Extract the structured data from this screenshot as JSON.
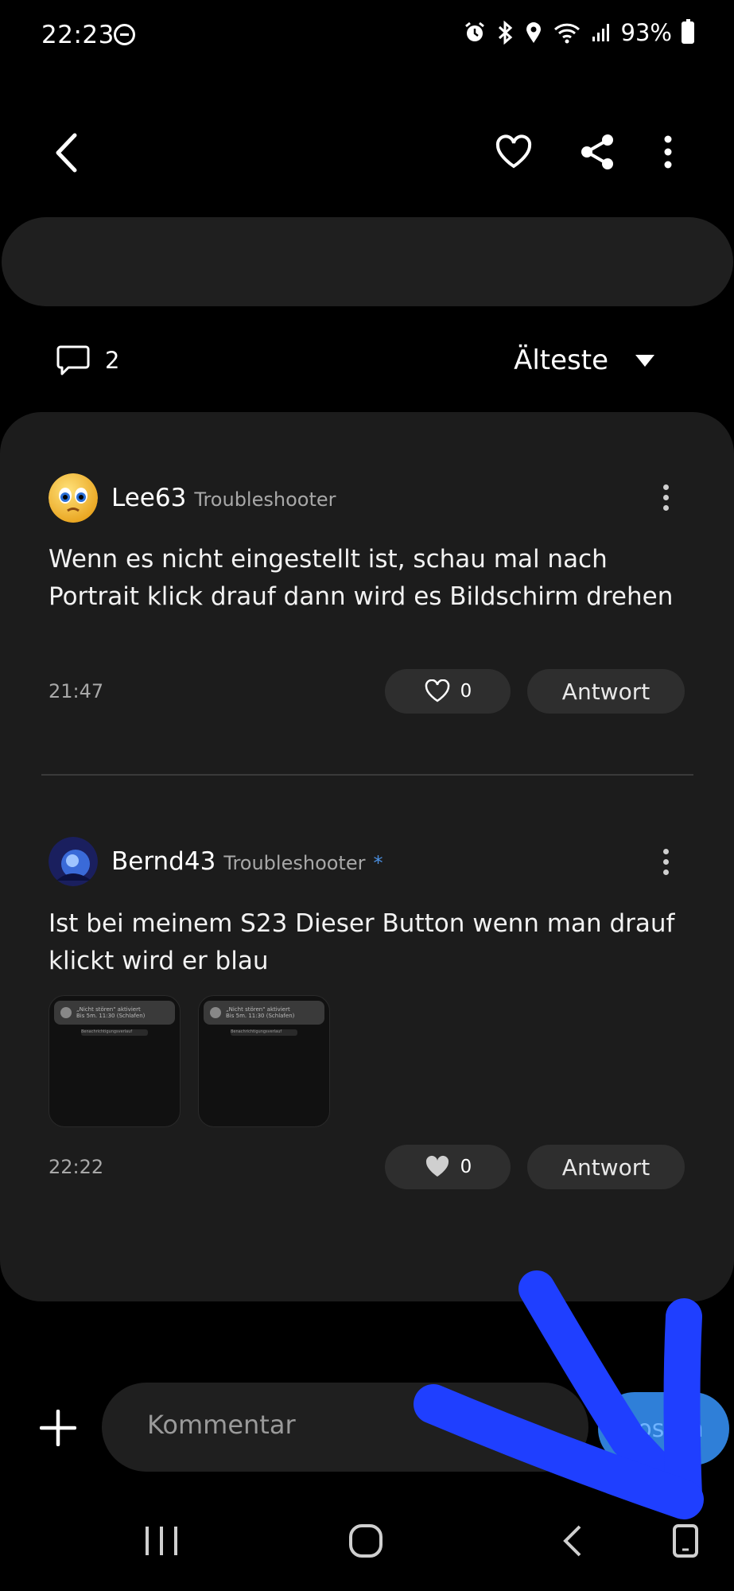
{
  "status_bar": {
    "time": "22:23",
    "battery": "93%",
    "icons": [
      "do-not-disturb-icon",
      "alarm-icon",
      "bluetooth-icon",
      "location-icon",
      "wifi-icon",
      "signal-icon",
      "battery-icon"
    ]
  },
  "top_bar": {
    "icons": [
      "back-icon",
      "heart-icon",
      "share-icon",
      "more-icon"
    ]
  },
  "meta": {
    "comment_count": "2",
    "sort_label": "Älteste"
  },
  "comments": [
    {
      "author": "Lee63",
      "role": "Troubleshooter",
      "text": "Wenn es nicht eingestellt ist, schau mal nach Portrait klick drauf dann wird es Bildschirm drehen",
      "time": "21:47",
      "likes": "0",
      "reply_label": "Antwort"
    },
    {
      "author": "Bernd43",
      "role": "Troubleshooter",
      "badge": "*",
      "text": "Ist bei meinem S23 Dieser Button wenn man drauf klickt wird er blau",
      "time": "22:22",
      "likes": "0",
      "reply_label": "Antwort",
      "attachments": [
        {
          "title": "„Nicht stören\" aktiviert",
          "subtitle": "Bis 5m. 11:30 (Schlafen)",
          "action": "Benachrichtigungsverlauf"
        },
        {
          "title": "„Nicht stören\" aktiviert",
          "subtitle": "Bis 5m. 11:30 (Schlafen)",
          "action": "Benachrichtigungsverlauf"
        }
      ]
    }
  ],
  "composer": {
    "placeholder": "Kommentar",
    "post_label": "Posten"
  },
  "annotation": {
    "color": "#1f3fff"
  },
  "colors": {
    "background": "#000000",
    "card": "#1c1c1c",
    "pill": "#2e2e2e",
    "accent": "#2f7fd8"
  }
}
